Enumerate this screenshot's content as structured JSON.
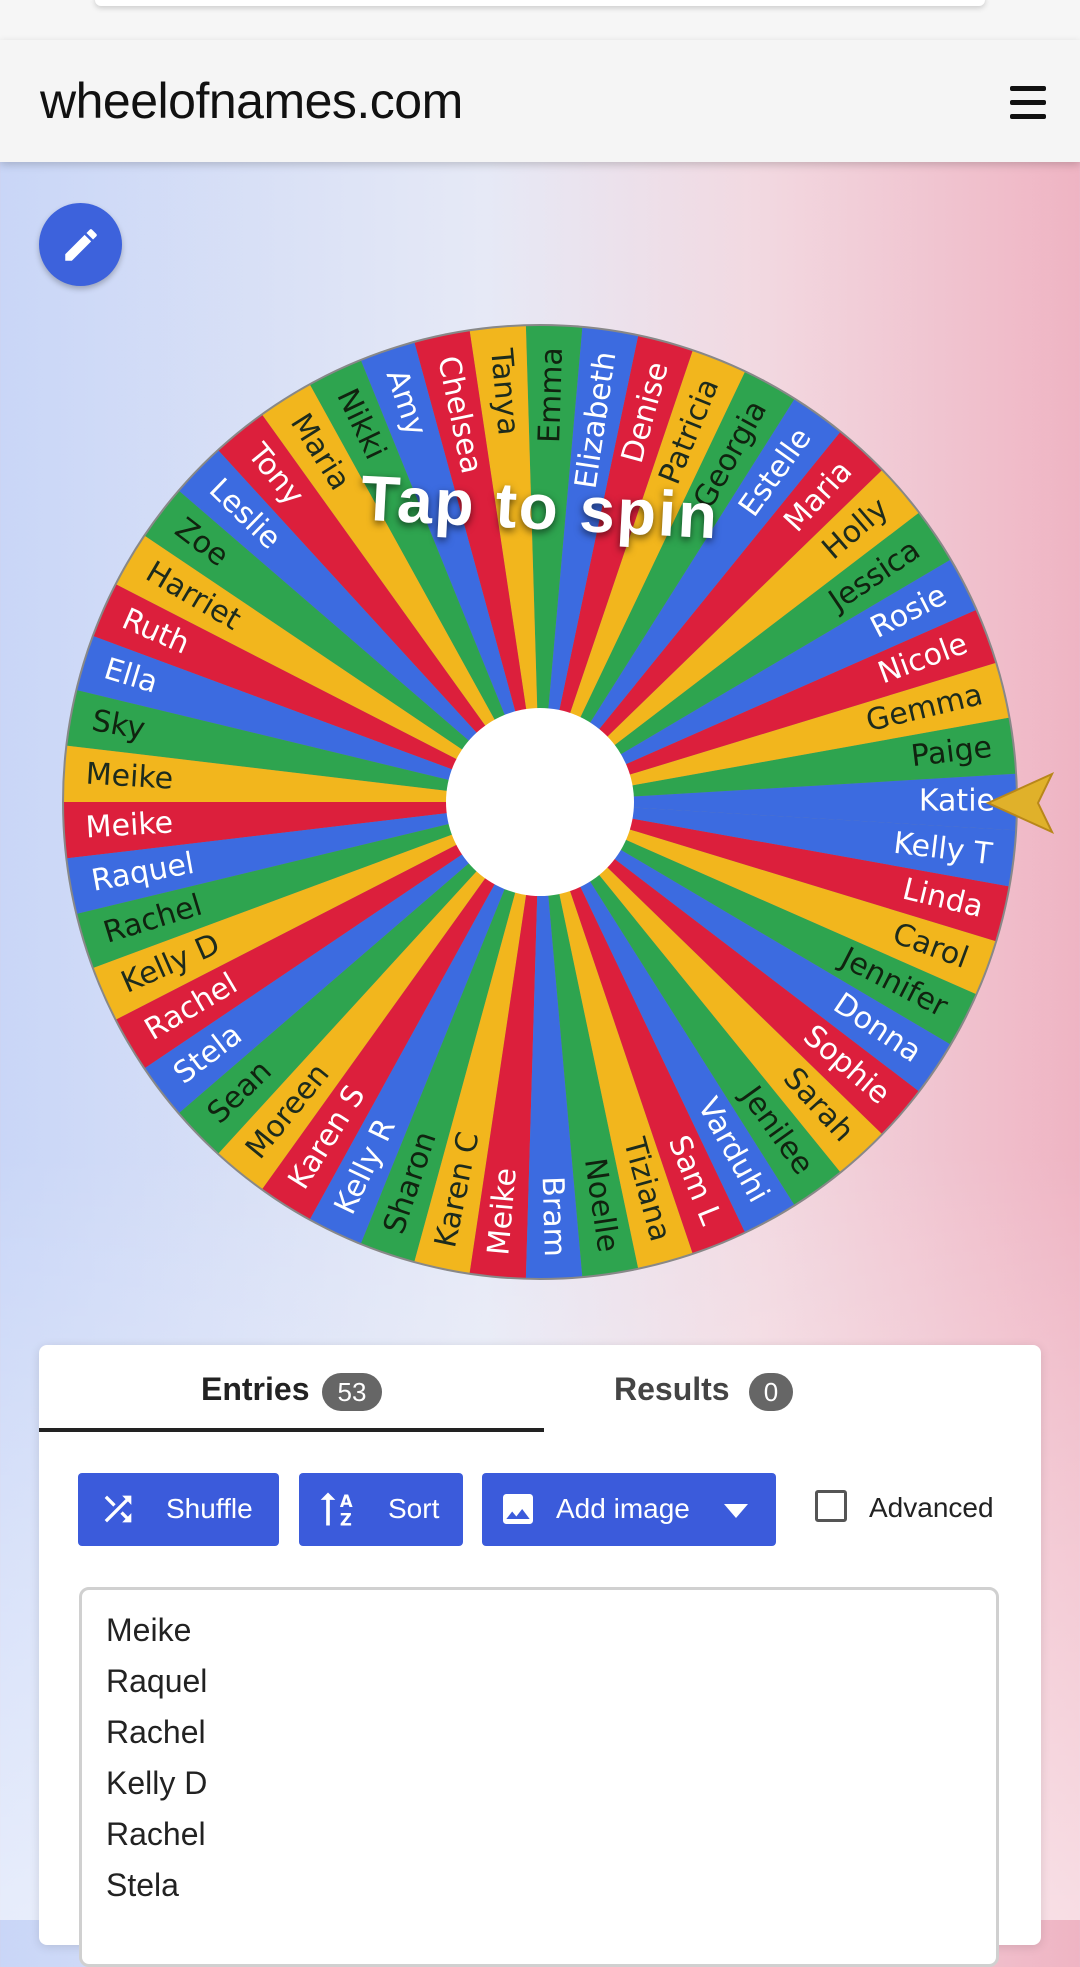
{
  "appbar": {
    "title": "wheelofnames.com"
  },
  "wheel": {
    "spin_label": "Tap to spin",
    "colors": [
      "#3c6be0",
      "#2ea44f",
      "#f2b61d",
      "#dc1f3c"
    ],
    "slices": [
      "Katie",
      "Paige",
      "Gemma",
      "Nicole",
      "Rosie",
      "Jessica",
      "Holly",
      "Maria",
      "Estelle",
      "Georgia",
      "Patricia",
      "Denise",
      "Elizabeth",
      "Emma",
      "Tanya",
      "Chelsea",
      "Amy",
      "Nikki",
      "Maria",
      "Tony",
      "Leslie",
      "Zoe",
      "Harriet",
      "Ruth",
      "Ella",
      "Sky",
      "Meike",
      "Meike",
      "Raquel",
      "Rachel",
      "Kelly D",
      "Rachel",
      "Stela",
      "Sean",
      "Moreen",
      "Karen S",
      "Kelly R",
      "Sharon",
      "Karen C",
      "Meike",
      "Bram",
      "Noelle",
      "Tiziana",
      "Sam L",
      "Varduhi",
      "Jenilee",
      "Sarah",
      "Sophie",
      "Donna",
      "Jennifer",
      "Carol",
      "Linda",
      "Kelly T"
    ]
  },
  "tabs": {
    "entries": {
      "label": "Entries",
      "count": "53"
    },
    "results": {
      "label": "Results",
      "count": "0"
    }
  },
  "toolbar": {
    "shuffle_label": "Shuffle",
    "sort_label": "Sort",
    "add_image_label": "Add image",
    "advanced_label": "Advanced"
  },
  "entries_list": [
    "Meike",
    "Raquel",
    "Rachel",
    "Kelly D",
    "Rachel",
    "Stela"
  ]
}
